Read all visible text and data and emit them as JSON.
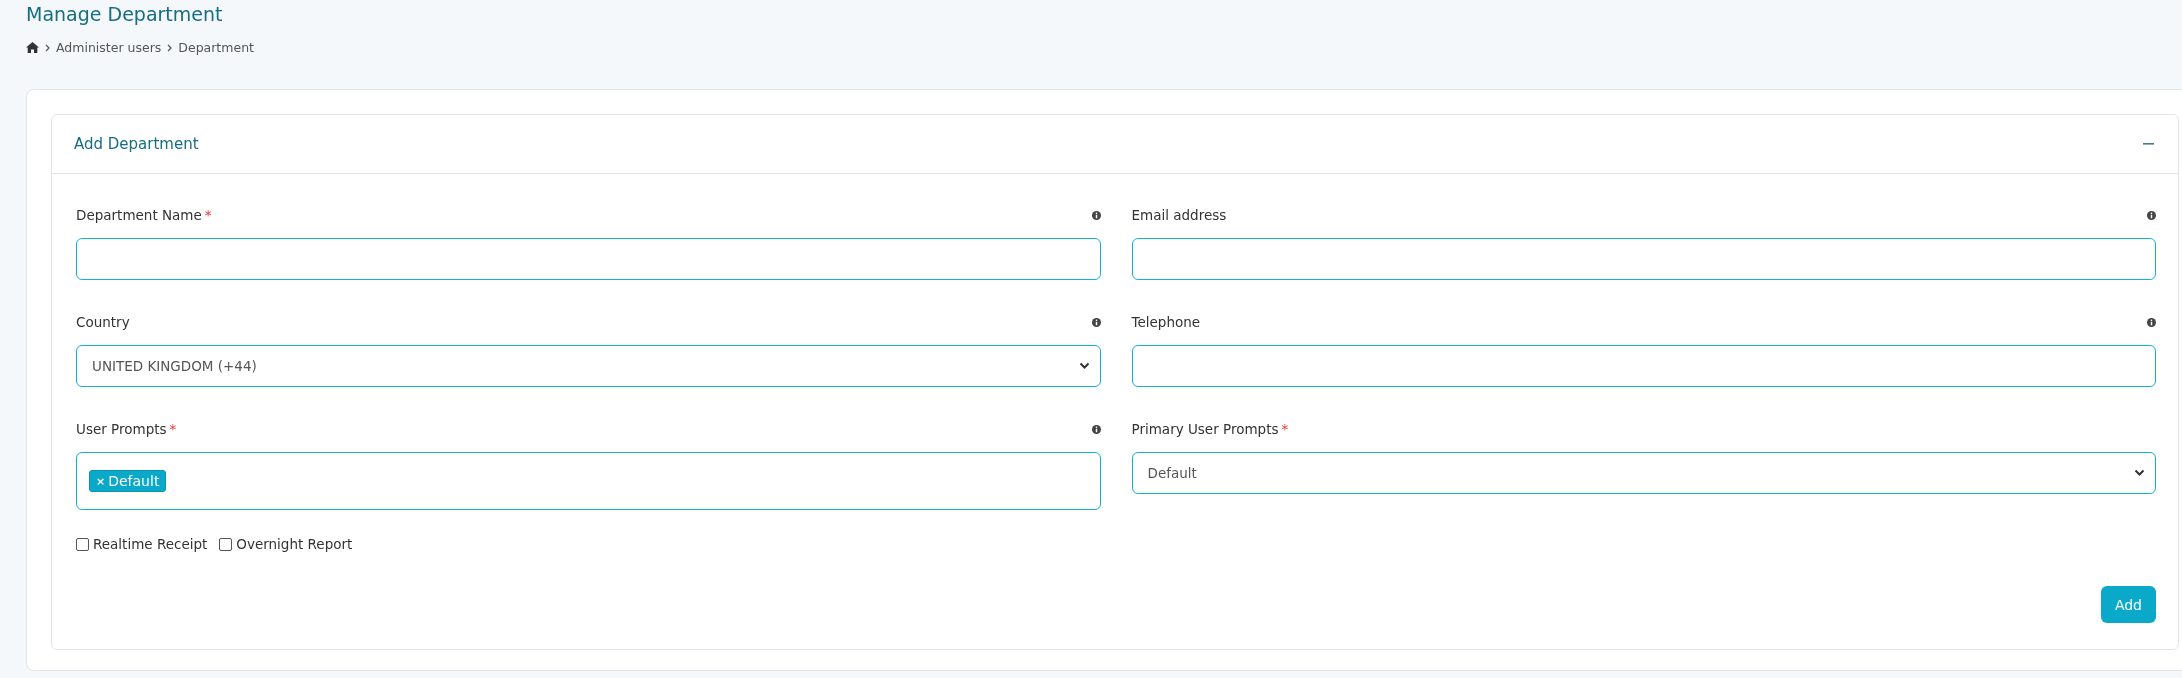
{
  "page_title": "Manage Department",
  "breadcrumb": [
    "Administer users",
    "Department"
  ],
  "card": {
    "title": "Add Department",
    "expanded": true
  },
  "fields": [
    {
      "kind": "text",
      "label": "Department Name",
      "required_mark": "*",
      "info": true
    },
    {
      "kind": "text",
      "label": "Email address",
      "info": true
    },
    {
      "kind": "select",
      "label": "Country",
      "info": true,
      "value": "UNITED KINGDOM (+44)"
    },
    {
      "kind": "text",
      "label": "Telephone",
      "info": true
    },
    {
      "kind": "tags",
      "label": "User Prompts",
      "required_mark": "*",
      "info": true,
      "tags": [
        {
          "remove": "×",
          "label": "Default"
        }
      ]
    },
    {
      "kind": "select",
      "label": "Primary User Prompts",
      "required_mark": "*",
      "info": false,
      "value": "Default"
    }
  ],
  "checkboxes": [
    {
      "label": "Realtime Receipt",
      "checked": false
    },
    {
      "label": "Overnight Report",
      "checked": false
    }
  ],
  "submit_button": "Add"
}
